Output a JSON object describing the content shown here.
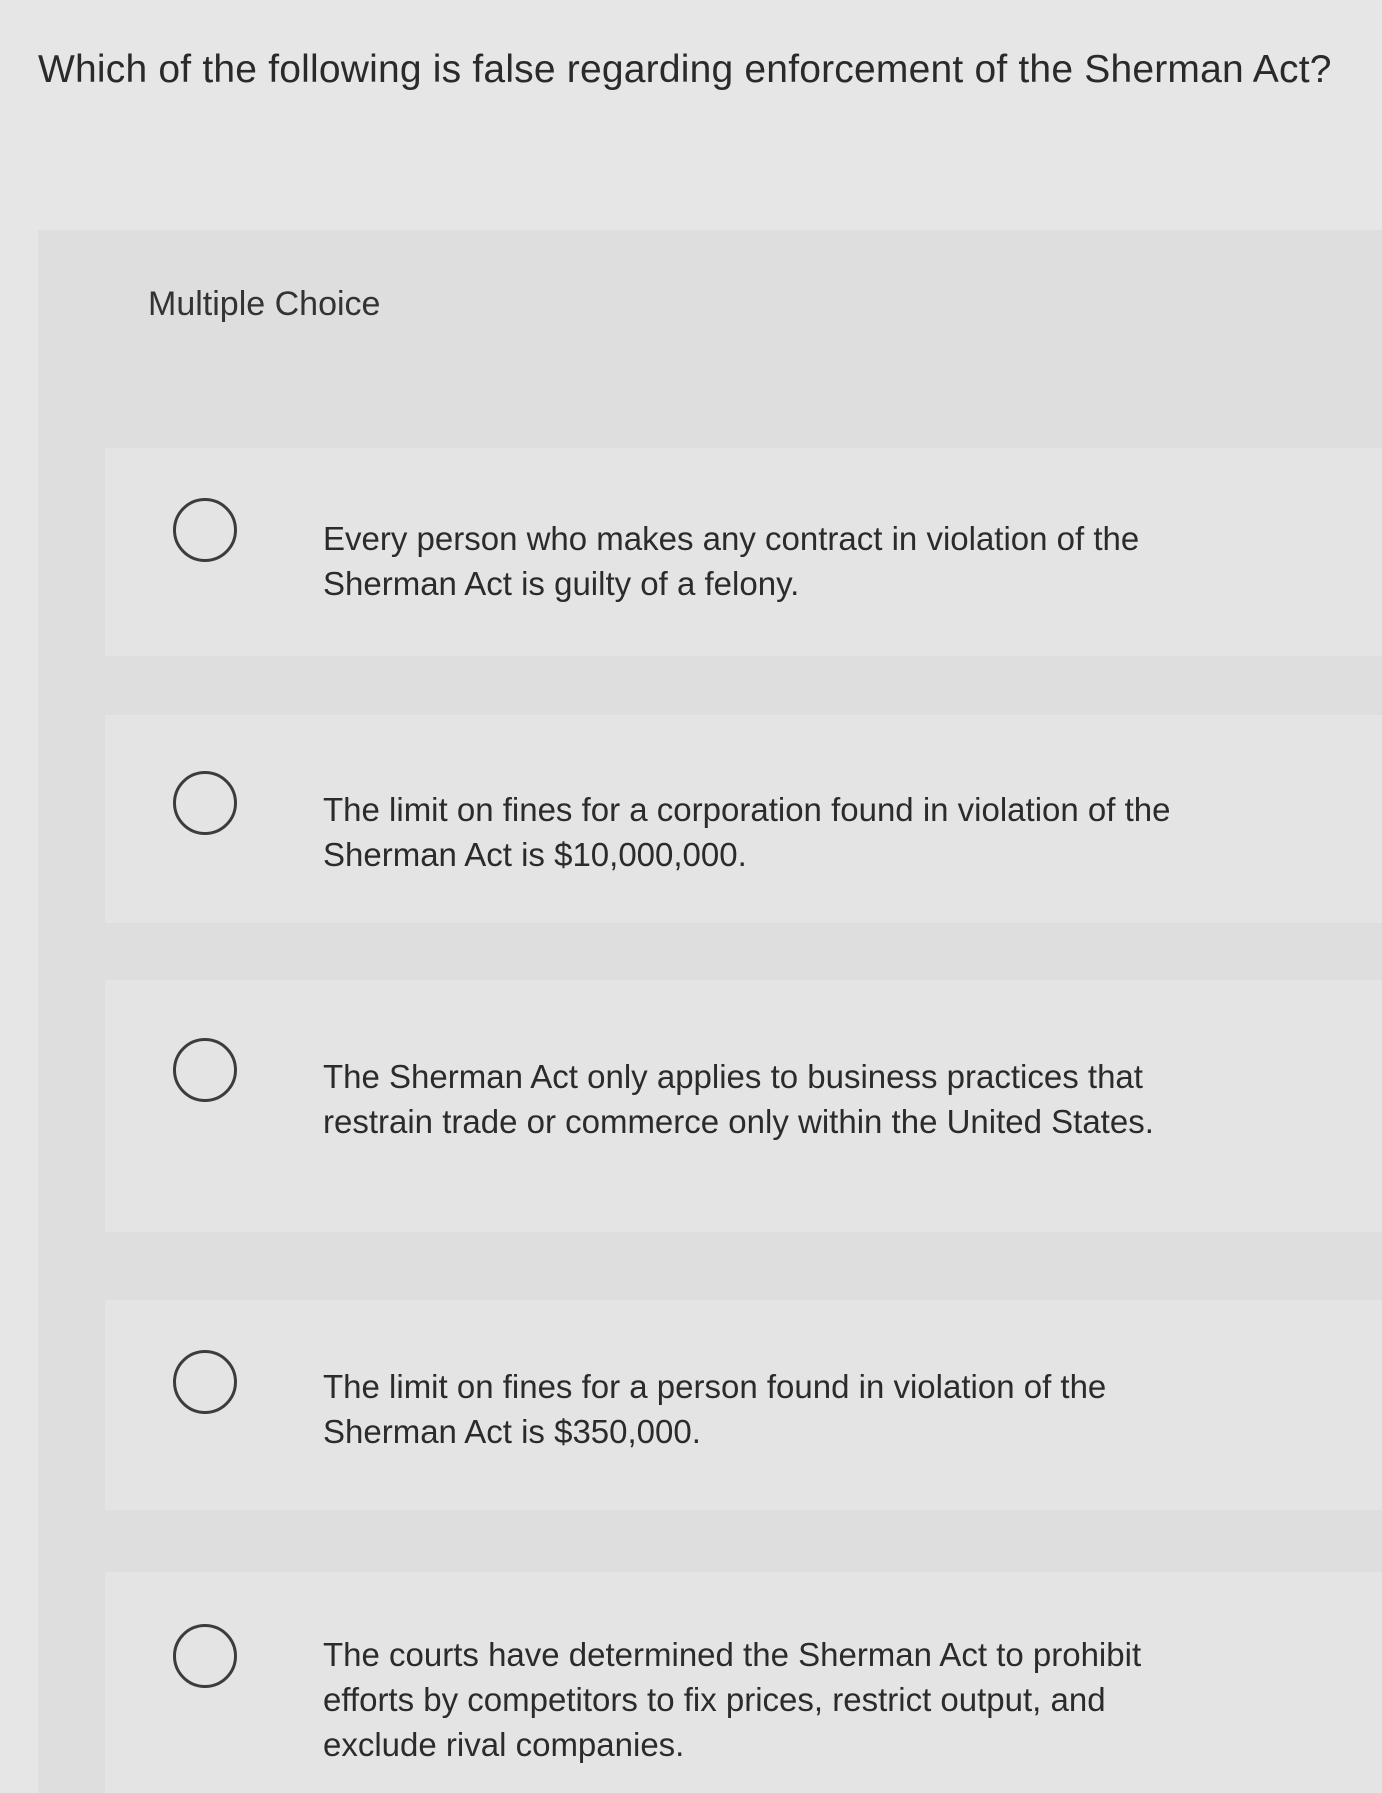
{
  "question": "Which of the following is false regarding enforcement of the Sherman Act?",
  "section_label": "Multiple Choice",
  "options": [
    {
      "text": "Every person who makes any contract in violation of the Sherman Act is guilty of a felony."
    },
    {
      "text": "The limit on fines for a corporation found in violation of the Sherman Act is $10,000,000."
    },
    {
      "text": "The Sherman Act only applies to business practices that restrain trade or commerce only within the United States."
    },
    {
      "text": "The limit on fines for a person found in violation of the Sherman Act is $350,000."
    },
    {
      "text": "The courts have determined the Sherman Act to prohibit efforts by competitors to fix prices, restrict output, and exclude rival companies."
    }
  ]
}
